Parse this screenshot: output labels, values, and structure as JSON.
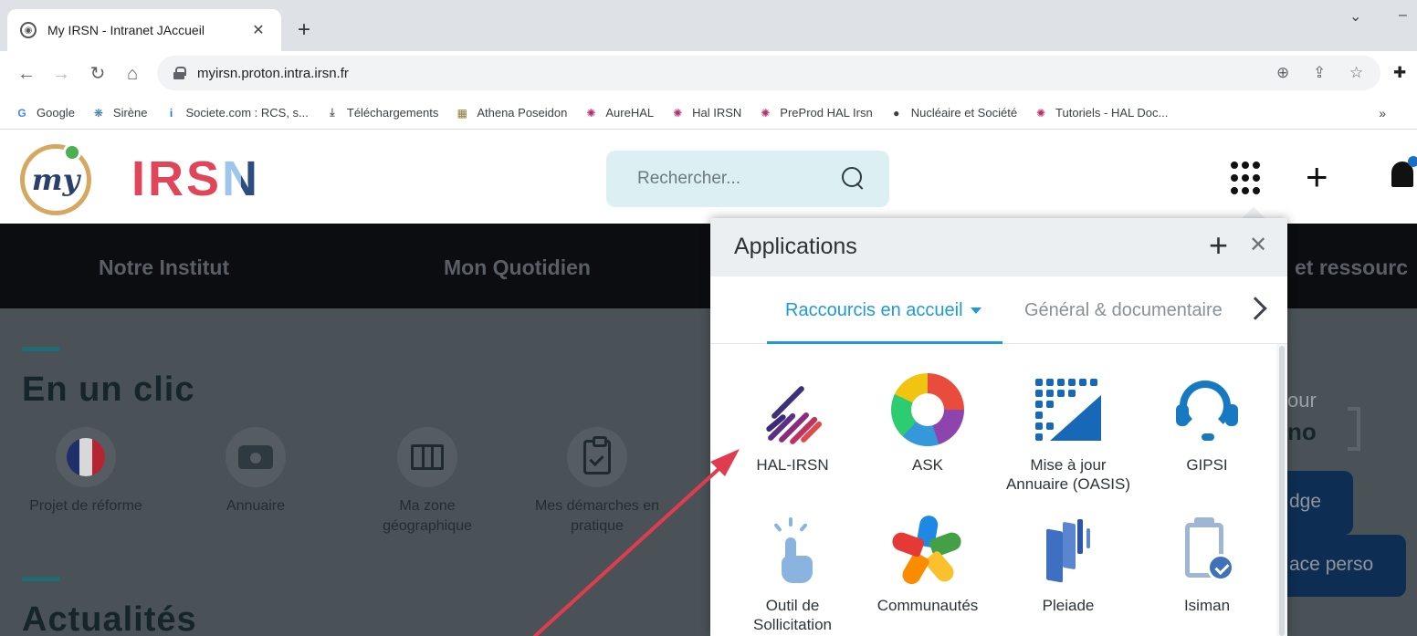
{
  "browser": {
    "tab_title": "My IRSN - Intranet JAccueil",
    "url": "myirsn.proton.intra.irsn.fr",
    "bookmarks": [
      {
        "label": "Google",
        "icon": "google-icon",
        "glyph": "G",
        "color": "#4285f4"
      },
      {
        "label": "Sirène",
        "icon": "sirene-icon",
        "glyph": "❋",
        "color": "#2d6ea8"
      },
      {
        "label": "Societe.com : RCS, s...",
        "icon": "info-icon",
        "glyph": "i",
        "color": "#1a73e8"
      },
      {
        "label": "Téléchargements",
        "icon": "download-icon",
        "glyph": "⤓",
        "color": "#5f6368"
      },
      {
        "label": "Athena Poseidon",
        "icon": "athena-icon",
        "glyph": "▦",
        "color": "#8a7b3c"
      },
      {
        "label": "AureHAL",
        "icon": "hal-icon",
        "glyph": "✺",
        "color": "#b5306b"
      },
      {
        "label": "Hal IRSN",
        "icon": "hal-icon",
        "glyph": "✺",
        "color": "#b5306b"
      },
      {
        "label": "PreProd HAL Irsn",
        "icon": "hal-icon",
        "glyph": "✺",
        "color": "#b5306b"
      },
      {
        "label": "Nucléaire et Société",
        "icon": "globe-icon",
        "glyph": "●",
        "color": "#3c4043"
      },
      {
        "label": "Tutoriels - HAL Doc...",
        "icon": "hal-icon",
        "glyph": "✺",
        "color": "#b5306b"
      }
    ],
    "more_bookmarks": "»"
  },
  "site": {
    "logo_text": "my",
    "brand": "IRS",
    "brand_last": "N",
    "search_placeholder": "Rechercher...",
    "nav": [
      "Notre Institut",
      "Mon Quotidien",
      "et ressourc"
    ],
    "section_quick": "En un clic",
    "quick_links": [
      "Projet de réforme",
      "Annuaire",
      "Ma zone géographique",
      "Mes démarches en pratique"
    ],
    "section_news": "Actualités",
    "right_fragments": {
      "pour": "our",
      "nom": "no",
      "badge": "dge",
      "space": "ace perso"
    }
  },
  "apps_panel": {
    "title": "Applications",
    "tab_active": "Raccourcis en accueil",
    "tab_other": "Général & documentaire",
    "apps": [
      {
        "label": "HAL-IRSN",
        "icon": "hal-irsn-icon"
      },
      {
        "label": "ASK",
        "icon": "ask-icon"
      },
      {
        "label": "Mise à jour Annuaire (OASIS)",
        "icon": "oasis-icon"
      },
      {
        "label": "GIPSI",
        "icon": "headset-icon"
      },
      {
        "label": "Outil de Sollicitation",
        "icon": "touch-icon"
      },
      {
        "label": "Communautés",
        "icon": "communities-icon"
      },
      {
        "label": "Pleiade",
        "icon": "pleiade-icon"
      },
      {
        "label": "Isiman",
        "icon": "clipboard-check-icon"
      }
    ]
  },
  "colors": {
    "brand_red": "#e0455a",
    "brand_blue": "#2c4d80",
    "accent": "#1d9bd7",
    "annotation_arrow": "#e03c50"
  }
}
